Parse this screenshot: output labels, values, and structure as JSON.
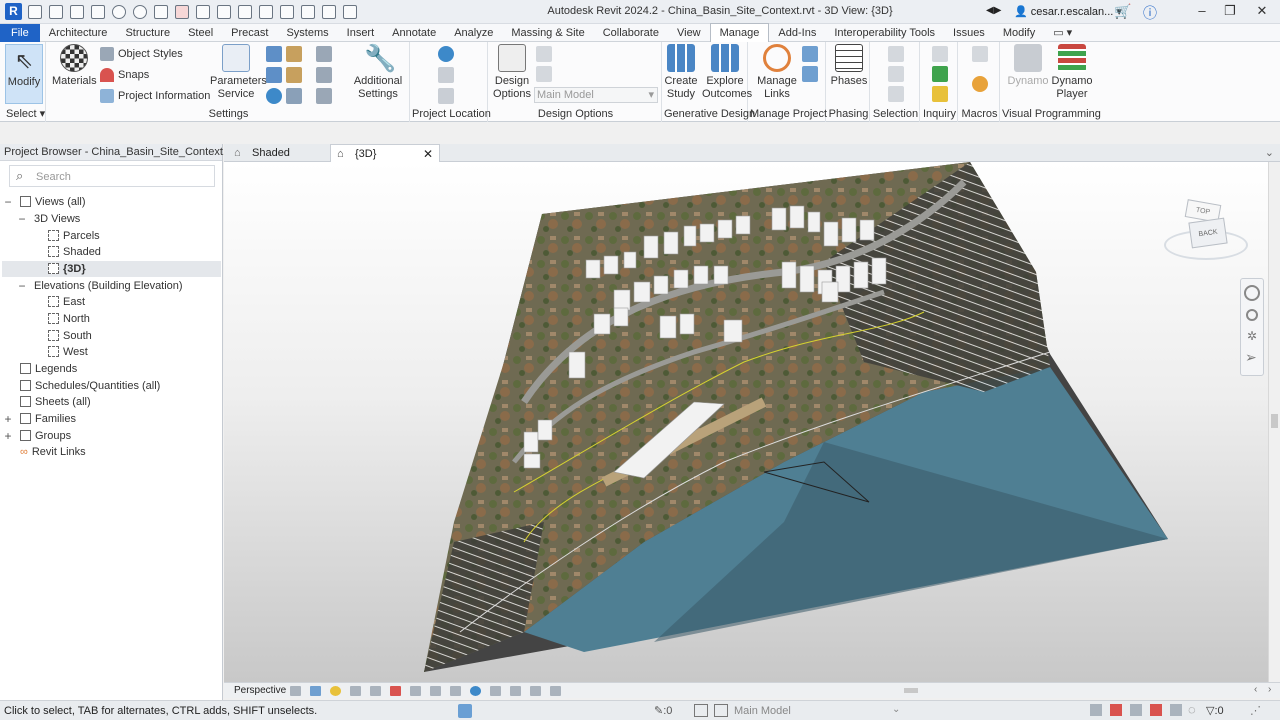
{
  "app": {
    "title": "Autodesk Revit 2024.2 - China_Basin_Site_Context.rvt - 3D View: {3D}",
    "user": "cesar.r.escalan...",
    "icon_letter": "R"
  },
  "tabs": [
    "File",
    "Architecture",
    "Structure",
    "Steel",
    "Precast",
    "Systems",
    "Insert",
    "Annotate",
    "Analyze",
    "Massing & Site",
    "Collaborate",
    "View",
    "Manage",
    "Add-Ins",
    "Interoperability Tools",
    "Issues",
    "Modify"
  ],
  "active_tab": "Manage",
  "ribbon": {
    "select": {
      "modify": "Modify",
      "panel": "Select"
    },
    "settings": {
      "materials": "Materials",
      "object_styles": "Object Styles",
      "snaps": "Snaps",
      "project_information": "Project Information",
      "parameters_service_1": "Parameters",
      "parameters_service_2": "Service",
      "additional_settings_1": "Additional",
      "additional_settings_2": "Settings",
      "panel": "Settings"
    },
    "project_location": {
      "panel": "Project Location"
    },
    "design_options": {
      "btn_1": "Design",
      "btn_2": "Options",
      "dropdown": "Main Model",
      "panel": "Design Options"
    },
    "generative_design": {
      "create_study_1": "Create",
      "create_study_2": "Study",
      "explore_1": "Explore",
      "explore_2": "Outcomes",
      "panel": "Generative Design"
    },
    "manage_project": {
      "manage_links_1": "Manage",
      "manage_links_2": "Links",
      "panel": "Manage Project"
    },
    "phasing": {
      "phases": "Phases",
      "panel": "Phasing"
    },
    "selection": {
      "panel": "Selection"
    },
    "inquiry": {
      "panel": "Inquiry"
    },
    "macros": {
      "panel": "Macros"
    },
    "visual_programming": {
      "dynamo": "Dynamo",
      "dynamo_player_1": "Dynamo",
      "dynamo_player_2": "Player",
      "panel": "Visual Programming"
    }
  },
  "browser": {
    "title": "Project Browser - China_Basin_Site_Context.rvt",
    "search_placeholder": "Search",
    "nodes": {
      "views_all": "Views (all)",
      "views_3d": "3D Views",
      "parcels": "Parcels",
      "shaded": "Shaded",
      "view_3d": "{3D}",
      "elevations": "Elevations (Building Elevation)",
      "east": "East",
      "north": "North",
      "south": "South",
      "west": "West",
      "legends": "Legends",
      "schedules": "Schedules/Quantities (all)",
      "sheets": "Sheets (all)",
      "families": "Families",
      "groups": "Groups",
      "revit_links": "Revit Links"
    }
  },
  "view_tabs": [
    {
      "label": "Shaded"
    },
    {
      "label": "{3D}"
    }
  ],
  "viewcube": {
    "back": "BACK",
    "top": "TOP"
  },
  "view_control": {
    "perspective": "Perspective"
  },
  "status": {
    "message": "Click to select, TAB for alternates, CTRL adds, SHIFT unselects.",
    "workset_count": ":0",
    "design_option": "Main Model",
    "filter_count": ":0"
  },
  "colors": {
    "accent": "#1f63c6",
    "water": "#4f7f93",
    "terrain": "#6a6a50",
    "building": "#f2f2f2",
    "contour_highlight": "#d6d230"
  }
}
